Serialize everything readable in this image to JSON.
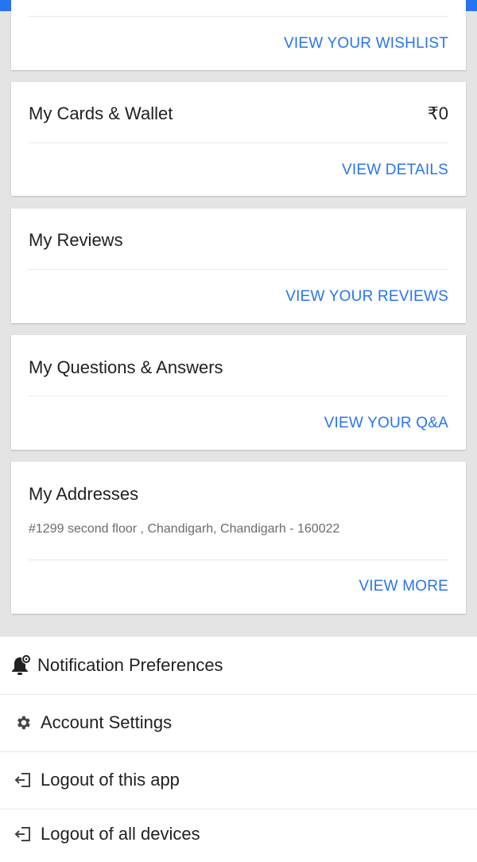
{
  "wishlist": {
    "link": "VIEW YOUR WISHLIST"
  },
  "cards_wallet": {
    "title": "My Cards & Wallet",
    "amount": "₹0",
    "link": "VIEW DETAILS"
  },
  "reviews": {
    "title": "My Reviews",
    "link": "VIEW YOUR REVIEWS"
  },
  "qa": {
    "title": "My Questions & Answers",
    "link": "VIEW YOUR Q&A"
  },
  "addresses": {
    "title": "My Addresses",
    "address": "#1299 second floor , Chandigarh, Chandigarh - 160022",
    "link": "VIEW MORE"
  },
  "menu": {
    "items": [
      {
        "label": "Notification Preferences",
        "icon": "bell-gear-icon"
      },
      {
        "label": "Account Settings",
        "icon": "gear-icon"
      },
      {
        "label": "Logout of this app",
        "icon": "logout-icon"
      },
      {
        "label": "Logout of all devices",
        "icon": "logout-icon"
      }
    ]
  },
  "colors": {
    "accent": "#2874f0",
    "background": "#e4e4e4",
    "card": "#ffffff",
    "muted_text": "#6b6b6b"
  }
}
